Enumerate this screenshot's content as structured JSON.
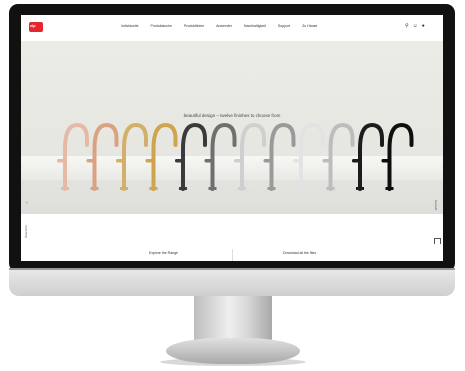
{
  "header": {
    "logo_text": "zip",
    "tagline": "",
    "nav": [
      "Individuelle",
      "Produktsuche",
      "Produktlinien",
      "Anwender",
      "Nachhaltigkeit",
      "Support",
      "Zu Hause"
    ],
    "icons": [
      "search-icon",
      "user-icon",
      "location-icon"
    ]
  },
  "hero": {
    "breadcrumb": "",
    "title": "beautiful design – twelve finishes to choose from",
    "tap_finishes": [
      "#e6b9a6",
      "#d9a383",
      "#d2b06a",
      "#cfa44f",
      "#3a3a3a",
      "#6f6f6f",
      "#cfcfcf",
      "#9a9a9a",
      "#e3e3e3",
      "#bdbdbd",
      "#1c1c1c",
      "#0e0e0e"
    ]
  },
  "sidebar_left": {
    "label": "Übersicht"
  },
  "sidebar_right": {
    "label": "Kontakt"
  },
  "bottom": {
    "left_cta": "Explore the Range",
    "right_cta": "Download all the files"
  }
}
